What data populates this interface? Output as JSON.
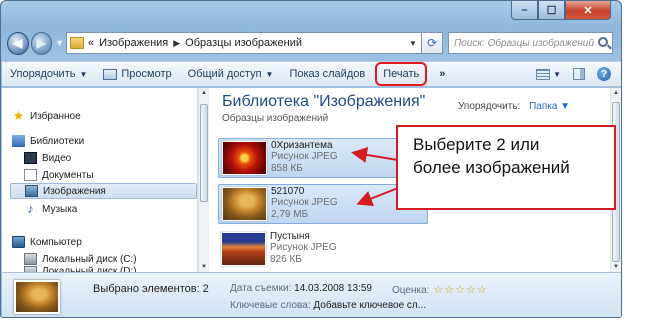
{
  "window": {
    "close_glyph": "✕",
    "minimize_glyph": "–",
    "maximize_glyph": "☐"
  },
  "nav": {
    "back_glyph": "◀",
    "forward_glyph": "▶",
    "breadcrumb_prefix": "«",
    "breadcrumb": [
      "Изображения",
      "Образцы изображений"
    ],
    "search_placeholder": "Поиск: Образцы изображений"
  },
  "toolbar": {
    "organize": "Упорядочить",
    "preview": "Просмотр",
    "share": "Общий доступ",
    "slideshow": "Показ слайдов",
    "print": "Печать",
    "more": "»"
  },
  "sidebar": {
    "favorites": "Избранное",
    "libraries": "Библиотеки",
    "video": "Видео",
    "documents": "Документы",
    "images": "Изображения",
    "music": "Музыка",
    "computer": "Компьютер",
    "local_disk_c": "Локальный диск (C:)",
    "local_disk_d": "Локальный диск (D:)"
  },
  "library": {
    "title": "Библиотека \"Изображения\"",
    "subtitle": "Образцы изображений",
    "arrange_label": "Упорядочить:",
    "arrange_value": "Папка"
  },
  "files": [
    {
      "name": "0Хризантема",
      "type": "Рисунок JPEG",
      "size": "858 КБ",
      "selected": true
    },
    {
      "name": "521070",
      "type": "Рисунок JPEG",
      "size": "2,79 МБ",
      "selected": true
    },
    {
      "name": "Пустыня",
      "type": "Рисунок JPEG",
      "size": "826 КБ",
      "selected": false
    }
  ],
  "details": {
    "selected_count": "Выбрано элементов: 2",
    "date_label": "Дата съемки:",
    "date_value": "14.03.2008 13:59",
    "keywords_label": "Ключевые слова:",
    "keywords_value": "Добавьте ключевое сл...",
    "rating_label": "Оценка:",
    "rating_stars": "☆☆☆☆☆"
  },
  "callout": {
    "line1": "Выберите 2 или",
    "line2": "более изображений"
  },
  "colors": {
    "highlight": "#e0191d",
    "accent": "#1e4b8a",
    "selection": "#bfd6f0"
  }
}
